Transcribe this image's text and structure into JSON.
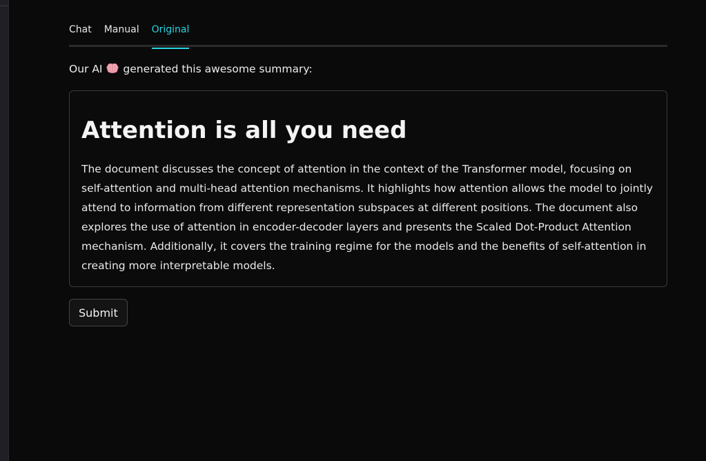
{
  "tabs": [
    {
      "label": "Chat",
      "active": false
    },
    {
      "label": "Manual",
      "active": false
    },
    {
      "label": "Original",
      "active": true
    }
  ],
  "intro": {
    "before": "Our AI",
    "icon": "brain-emoji",
    "after": "generated this awesome summary:"
  },
  "summary": {
    "title": "Attention is all you need",
    "body": "The document discusses the concept of attention in the context of the Transformer model, focusing on self-attention and multi-head attention mechanisms. It highlights how attention allows the model to jointly attend to information from different representation subspaces at different positions. The document also explores the use of attention in encoder-decoder layers and presents the Scaled Dot-Product Attention mechanism. Additionally, it covers the training regime for the models and the benefits of self-attention in creating more interpretable models."
  },
  "actions": {
    "submit_label": "Submit"
  },
  "colors": {
    "accent": "#2ad4e0",
    "background": "#0a0a0a",
    "border": "#3a3a3a"
  }
}
